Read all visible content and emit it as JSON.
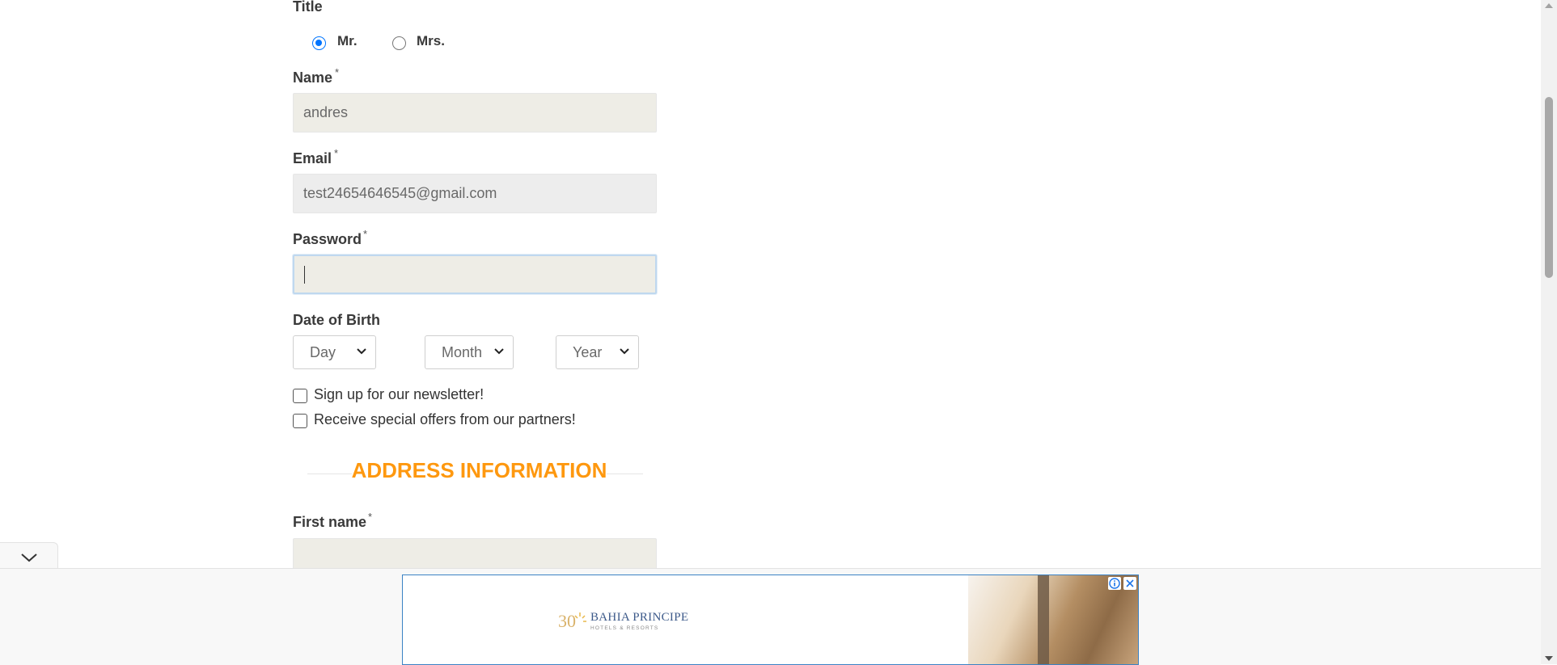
{
  "form": {
    "title_label": "Title",
    "titles": [
      "Mr.",
      "Mrs."
    ],
    "selected_title": "Mr.",
    "name": {
      "label": "Name",
      "required_mark": "*",
      "value": "andres"
    },
    "email": {
      "label": "Email",
      "required_mark": "*",
      "value": "test24654646545@gmail.com"
    },
    "password": {
      "label": "Password",
      "required_mark": "*",
      "value": ""
    },
    "dob": {
      "label": "Date of Birth",
      "day": "Day",
      "month": "Month",
      "year": "Year"
    },
    "newsletter": {
      "label": "Sign up for our newsletter!",
      "checked": false
    },
    "offers": {
      "label": "Receive special offers from our partners!",
      "checked": false
    }
  },
  "address": {
    "section_title": "ADDRESS INFORMATION",
    "first_name": {
      "label": "First name",
      "required_mark": "*",
      "value": ""
    }
  },
  "ad": {
    "brand": "BAHIA PRINCIPE",
    "tagline": "HOTELS & RESORTS",
    "logo_mark": "30",
    "border_color": "#3b82c4",
    "brand_color": "#3d5a8a"
  },
  "colors": {
    "accent_orange": "#fe980f",
    "radio_blue": "#0075ff",
    "field_bg": "#eeede6"
  }
}
